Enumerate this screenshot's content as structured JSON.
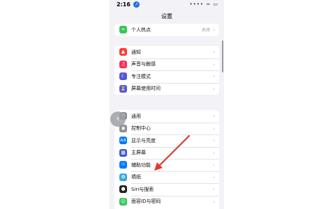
{
  "status": {
    "time": "2:16",
    "loc_badge": "↗",
    "icons": "•••• ≈ ▭"
  },
  "nav": {
    "title": "设置"
  },
  "group_hotspot": [
    {
      "label": "个人热点",
      "value": "关闭",
      "icon": "link-icon",
      "color": "#34c759"
    }
  ],
  "group_notify": [
    {
      "label": "通知",
      "icon": "bell-icon",
      "color": "#ff3b30"
    },
    {
      "label": "声音与触感",
      "icon": "speaker-icon",
      "color": "#ff2d55"
    },
    {
      "label": "专注模式",
      "icon": "moon-icon",
      "color": "#5856d6"
    },
    {
      "label": "屏幕使用时间",
      "icon": "hourglass-icon",
      "color": "#5856d6"
    }
  ],
  "group_general": [
    {
      "label": "通用",
      "icon": "gear-icon",
      "color": "#8e8e93"
    },
    {
      "label": "控制中心",
      "icon": "switches-icon",
      "color": "#8e8e93"
    },
    {
      "label": "显示与亮度",
      "icon": "aa-icon",
      "color": "#007aff"
    },
    {
      "label": "主屏幕",
      "icon": "home-grid-icon",
      "color": "#3a54d6"
    },
    {
      "label": "辅助功能",
      "icon": "accessibility-icon",
      "color": "#007aff"
    },
    {
      "label": "墙纸",
      "icon": "wallpaper-icon",
      "color": "#35aadc"
    },
    {
      "label": "Siri与搜索",
      "icon": "siri-icon",
      "color": "#222222"
    },
    {
      "label": "面容ID与密码",
      "icon": "faceid-icon",
      "color": "#34c759"
    }
  ],
  "chevron": "›",
  "back_glyph": "‹",
  "arrow_color": "#e8362c"
}
